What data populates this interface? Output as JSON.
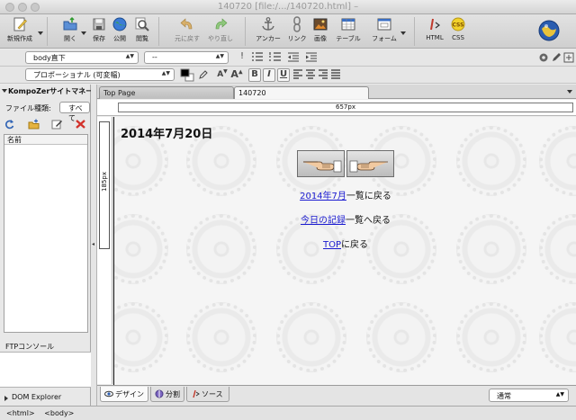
{
  "window": {
    "title": "140720 [file:/.../140720.html] –"
  },
  "toolbar": {
    "new": "新規作成",
    "open": "開く",
    "save": "保存",
    "publish": "公開",
    "browse": "閲覧",
    "undo": "元に戻す",
    "redo": "やり直し",
    "anchor": "アンカー",
    "link": "リンク",
    "image": "画像",
    "table": "テーブル",
    "form": "フォーム",
    "html": "HTML",
    "css": "CSS"
  },
  "format1": {
    "paragraph_select": "body直下",
    "class_select": "--"
  },
  "format2": {
    "font_select": "プロポーショナル (可変幅)",
    "bold": "B",
    "italic": "I",
    "underline": "U"
  },
  "sidebar": {
    "title": "KompoZerサイトマネー",
    "filetype_label": "ファイル種類:",
    "filetype_value": "すべて",
    "list_header": "名前",
    "ftp_label": "FTPコンソール",
    "dom_explorer": "DOM Explorer"
  },
  "tabs": [
    {
      "label": "Top Page"
    },
    {
      "label": "140720"
    }
  ],
  "ruler": {
    "width_label": "657px",
    "height_label": "185px"
  },
  "page": {
    "title": "2014年7月20日",
    "links": [
      {
        "link": "2014年7月",
        "rest": "一覧に戻る"
      },
      {
        "link": "今日の記録",
        "rest": "一覧へ戻る"
      },
      {
        "link": "TOP",
        "rest": "に戻る"
      }
    ]
  },
  "modes": {
    "design": "デザイン",
    "split": "分割",
    "source": "ソース",
    "view_select": "通常"
  },
  "status": {
    "tag1": "<html>",
    "tag2": "<body>"
  }
}
